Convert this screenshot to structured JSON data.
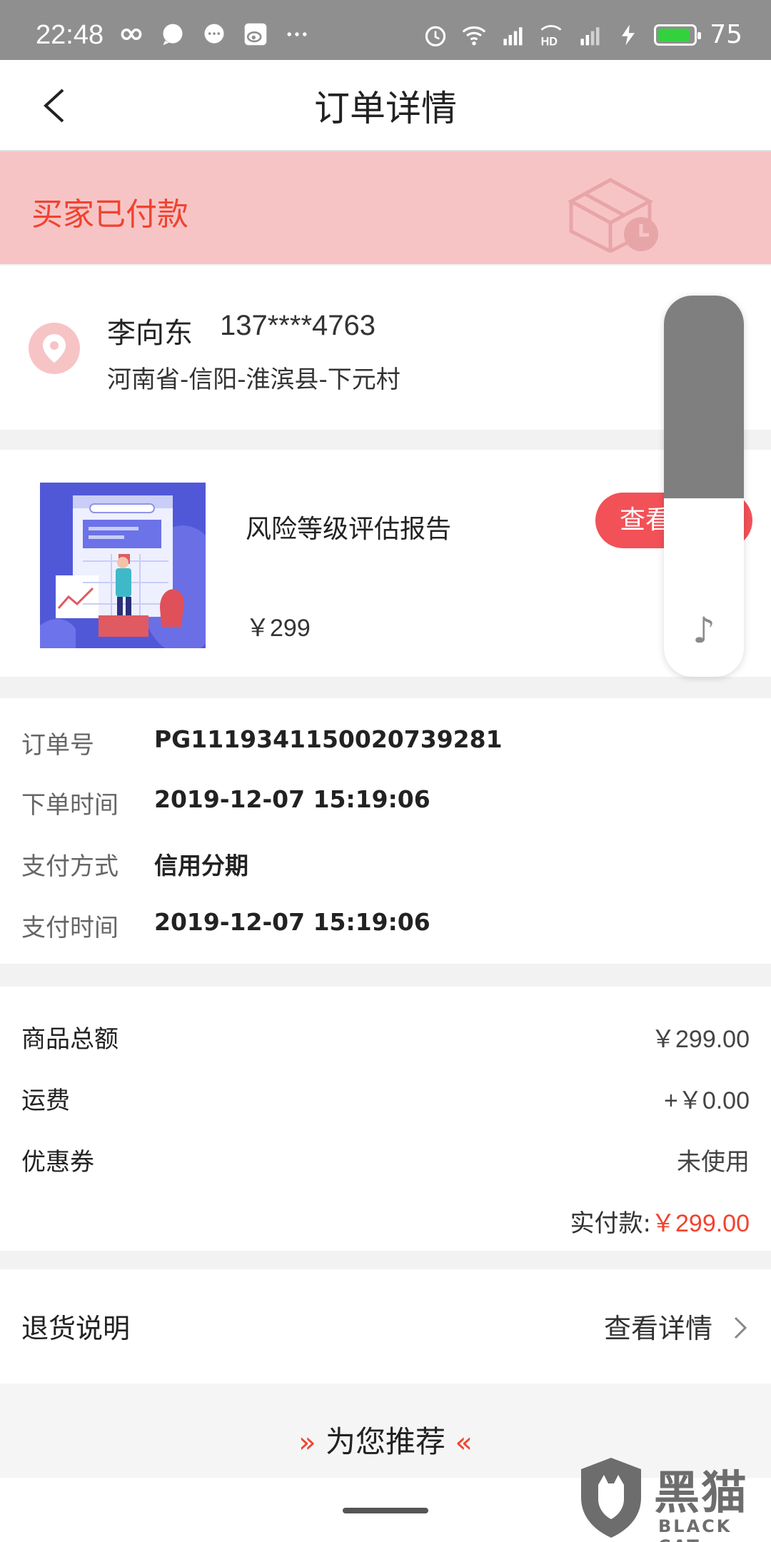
{
  "status_bar": {
    "time": "22:48",
    "battery": "75",
    "left_icons": [
      "infinity-icon",
      "chat-bubble-icon",
      "message-icon",
      "weibo-icon",
      "more-dots-icon"
    ],
    "right_icons": [
      "alarm-icon",
      "wifi-icon",
      "signal-4g-icon",
      "hd-icon",
      "signal-4g-icon",
      "charging-icon",
      "battery-icon"
    ]
  },
  "header": {
    "title": "订单详情"
  },
  "order_status": {
    "text": "买家已付款"
  },
  "address": {
    "name": "李向东",
    "phone": "137****4763",
    "line": "河南省-信阳-淮滨县-下元村"
  },
  "product": {
    "name": "风险等级评估报告",
    "price": "￥299",
    "view_button": "查看"
  },
  "order_info": [
    {
      "label": "订单号",
      "value": "PG1119341150020739281"
    },
    {
      "label": "下单时间",
      "value": "2019-12-07 15:19:06"
    },
    {
      "label": "支付方式",
      "value": "信用分期"
    },
    {
      "label": "支付时间",
      "value": "2019-12-07 15:19:06"
    }
  ],
  "amounts": [
    {
      "label": "商品总额",
      "value": "￥299.00"
    },
    {
      "label": "运费",
      "value": "+￥0.00"
    },
    {
      "label": "优惠券",
      "value": "未使用"
    }
  ],
  "paid": {
    "label": "实付款:",
    "value": "￥299.00"
  },
  "refund": {
    "label": "退货说明",
    "link": "查看详情"
  },
  "recommend": {
    "label": "为您推荐"
  },
  "watermark": {
    "cn": "黑猫",
    "en": "BLACK CAT"
  },
  "colors": {
    "accent": "#f0432f",
    "banner_bg": "#f7c4c6",
    "button": "#f25158"
  }
}
